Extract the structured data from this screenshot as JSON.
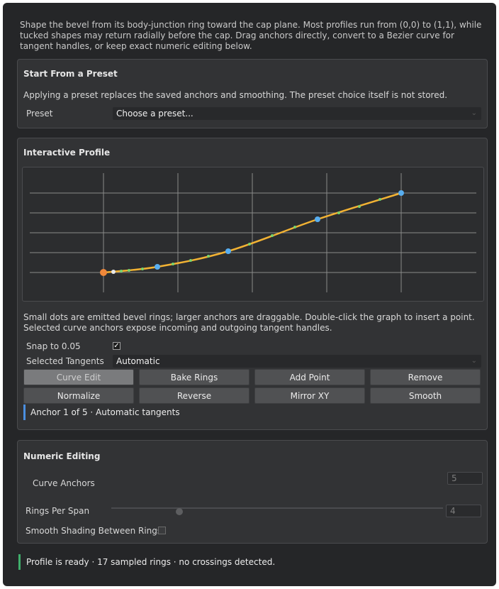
{
  "intro": "Shape the bevel from its body-junction ring toward the cap plane. Most profiles run from (0,0) to (1,1), while tucked shapes may return radially before the cap. Drag anchors directly, convert to a Bezier curve for tangent handles, or keep exact numeric editing below.",
  "preset_panel": {
    "title": "Start From a Preset",
    "description": "Applying a preset replaces the saved anchors and smoothing. The preset choice itself is not stored.",
    "preset_label": "Preset",
    "preset_value": "Choose a preset..."
  },
  "interactive_panel": {
    "title": "Interactive Profile",
    "help_line1": "Small dots are emitted bevel rings; larger anchors are draggable. Double-click the graph to insert a point.",
    "help_line2": "Selected curve anchors expose incoming and outgoing tangent handles.",
    "snap_label": "Snap to 0.05",
    "snap_checked": true,
    "tangents_label": "Selected Tangents",
    "tangents_value": "Automatic",
    "buttons_row1": [
      "Curve Edit",
      "Bake Rings",
      "Add Point",
      "Remove"
    ],
    "buttons_row2": [
      "Normalize",
      "Reverse",
      "Mirror XY",
      "Smooth"
    ],
    "anchor_info": "Anchor 1 of 5 · Automatic tangents",
    "colors": {
      "curve": "#f2b233",
      "anchor": "#58aef0",
      "selected_anchor": "#f0883a",
      "ring_dot": "#7bd36b"
    }
  },
  "numeric_panel": {
    "title": "Numeric Editing",
    "curve_anchors_label": "Curve Anchors",
    "curve_anchors_value": "5",
    "rings_per_span_label": "Rings Per Span",
    "rings_per_span_value": "4",
    "smooth_shading_label": "Smooth Shading Between Rings"
  },
  "status": "Profile is ready · 17 sampled rings · no crossings detected."
}
